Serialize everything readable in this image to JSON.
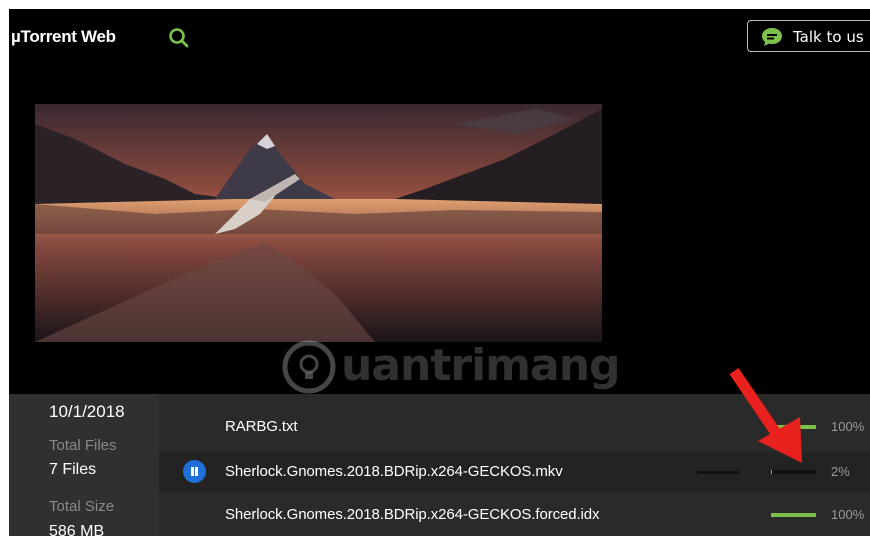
{
  "header": {
    "app_title": "µTorrent Web",
    "search_icon": "search-icon",
    "talk_label": "Talk to us",
    "talk_icon": "chat-bubble-icon"
  },
  "info": {
    "date": "10/1/2018",
    "total_files_label": "Total Files",
    "total_files_value": "7 Files",
    "total_size_label": "Total Size",
    "total_size_value": "586 MB"
  },
  "files": [
    {
      "name": "RARBG.txt",
      "progress": 100,
      "progress_label": "100%",
      "status": "complete"
    },
    {
      "name": "Sherlock.Gnomes.2018.BDRip.x264-GECKOS.mkv",
      "progress": 2,
      "progress_label": "2%",
      "status": "downloading",
      "status_icon": "pause-icon"
    },
    {
      "name": "Sherlock.Gnomes.2018.BDRip.x264-GECKOS.forced.idx",
      "progress": 100,
      "progress_label": "100%",
      "status": "complete"
    }
  ],
  "watermark": {
    "text": "uantrimang",
    "icon": "lightbulb-icon"
  },
  "colors": {
    "accent_green": "#7cc24a",
    "pause_blue": "#1f6fd8",
    "search_green": "#7cc24a",
    "arrow_red": "#e8201e"
  }
}
